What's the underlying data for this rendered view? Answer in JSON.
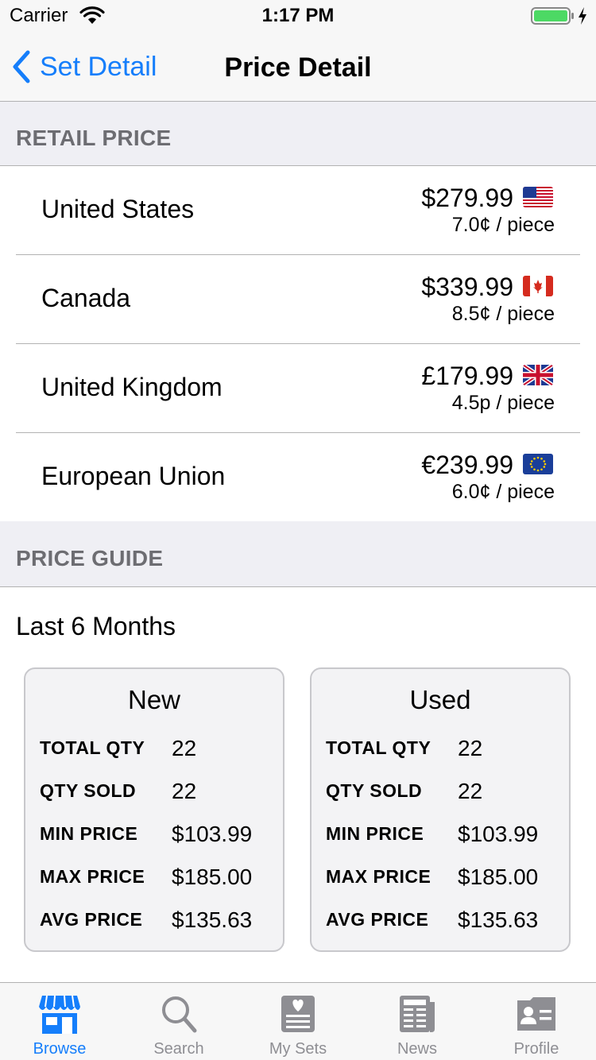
{
  "status": {
    "carrier": "Carrier",
    "time": "1:17 PM"
  },
  "nav": {
    "back_label": "Set Detail",
    "title": "Price Detail"
  },
  "retail": {
    "header": "RETAIL PRICE",
    "rows": [
      {
        "country": "United States",
        "price": "$279.99",
        "per_piece": "7.0¢ / piece",
        "flag": "us-flag-icon"
      },
      {
        "country": "Canada",
        "price": "$339.99",
        "per_piece": "8.5¢ / piece",
        "flag": "canada-flag-icon"
      },
      {
        "country": "United Kingdom",
        "price": "£179.99",
        "per_piece": "4.5p / piece",
        "flag": "uk-flag-icon"
      },
      {
        "country": "European Union",
        "price": "€239.99",
        "per_piece": "6.0¢ / piece",
        "flag": "eu-flag-icon"
      }
    ]
  },
  "guide": {
    "header": "PRICE GUIDE",
    "period": "Last 6 Months",
    "cards": [
      {
        "title": "New",
        "stats": [
          {
            "label": "TOTAL QTY",
            "value": "22"
          },
          {
            "label": "QTY SOLD",
            "value": "22"
          },
          {
            "label": "MIN PRICE",
            "value": "$103.99"
          },
          {
            "label": "MAX PRICE",
            "value": "$185.00"
          },
          {
            "label": "AVG PRICE",
            "value": "$135.63"
          }
        ]
      },
      {
        "title": "Used",
        "stats": [
          {
            "label": "TOTAL QTY",
            "value": "22"
          },
          {
            "label": "QTY SOLD",
            "value": "22"
          },
          {
            "label": "MIN PRICE",
            "value": "$103.99"
          },
          {
            "label": "MAX PRICE",
            "value": "$185.00"
          },
          {
            "label": "AVG PRICE",
            "value": "$135.63"
          }
        ]
      }
    ]
  },
  "tabs": [
    {
      "label": "Browse",
      "icon": "storefront-icon",
      "active": true
    },
    {
      "label": "Search",
      "icon": "search-icon",
      "active": false
    },
    {
      "label": "My Sets",
      "icon": "my-sets-icon",
      "active": false
    },
    {
      "label": "News",
      "icon": "newspaper-icon",
      "active": false
    },
    {
      "label": "Profile",
      "icon": "profile-card-icon",
      "active": false
    }
  ],
  "colors": {
    "accent": "#157efb",
    "section_bg": "#efeff4",
    "bar_bg": "#f7f7f7",
    "battery": "#4cd964"
  }
}
